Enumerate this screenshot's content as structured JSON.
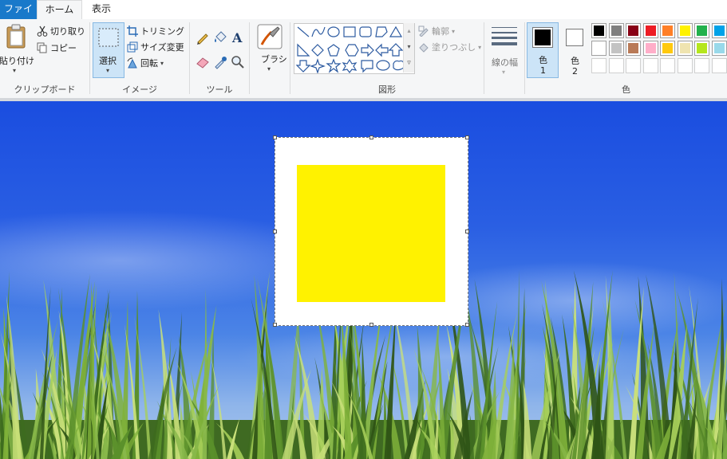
{
  "tabs": {
    "file": "ファイル",
    "home": "ホーム",
    "view": "表示"
  },
  "clipboard": {
    "paste": "貼り付け",
    "cut": "切り取り",
    "copy": "コピー",
    "label": "クリップボード"
  },
  "image": {
    "select": "選択",
    "crop": "トリミング",
    "resize": "サイズ変更",
    "rotate": "回転",
    "label": "イメージ"
  },
  "tools": {
    "label": "ツール"
  },
  "brushes": {
    "label": "ブラシ"
  },
  "shapes": {
    "outline": "輪郭",
    "fill": "塗りつぶし",
    "label": "図形"
  },
  "size": {
    "label": "線の幅"
  },
  "colors": {
    "color1_label": "色",
    "color1_num": "1",
    "color2_label": "色",
    "color2_num": "2",
    "group_label": "色",
    "color1_value": "#000000",
    "color2_value": "#ffffff",
    "palette_row1": [
      "#000000",
      "#7f7f7f",
      "#880015",
      "#ed1c24",
      "#ff7f27",
      "#fff200",
      "#22b14c",
      "#00a2e8"
    ],
    "palette_row2": [
      "#ffffff",
      "#c3c3c3",
      "#b97a57",
      "#ffaec9",
      "#ffc90e",
      "#efe4b0",
      "#b5e61d",
      "#99d9ea"
    ],
    "palette_row3": [
      "",
      "",
      "",
      "",
      "",
      "",
      "",
      ""
    ]
  },
  "canvas": {
    "background": "#ffffff",
    "shape_color": "#fff200"
  }
}
